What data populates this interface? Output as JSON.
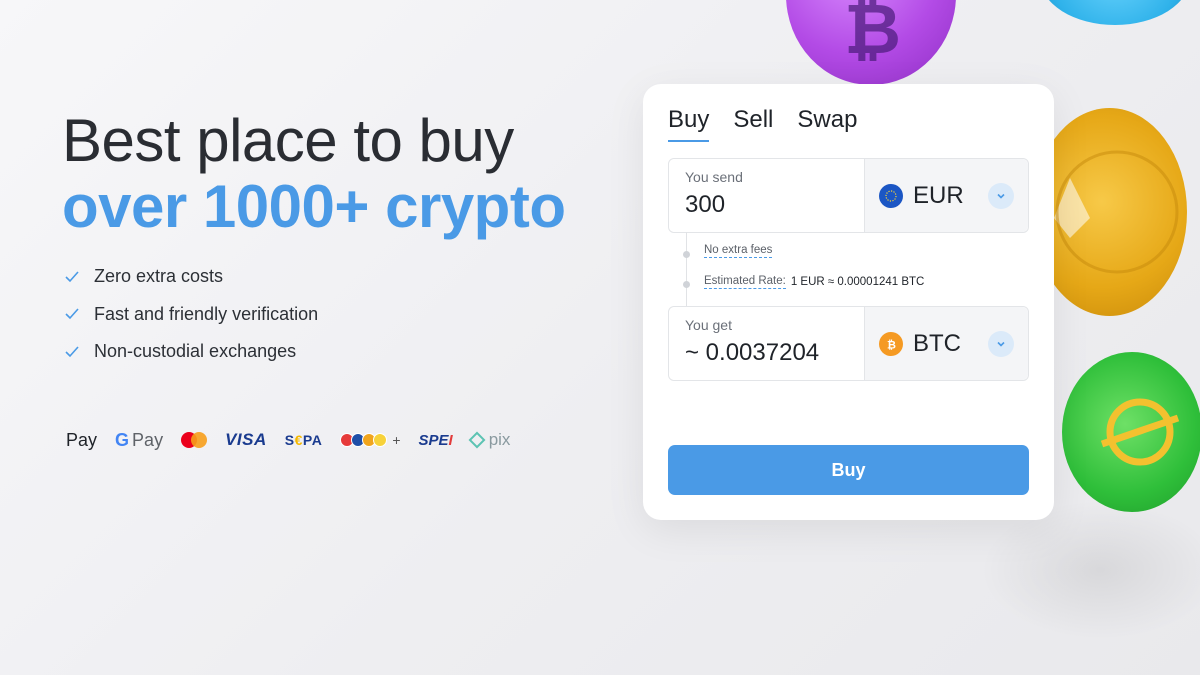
{
  "hero": {
    "line1": "Best place to buy",
    "line2": "over 1000+ crypto"
  },
  "features": [
    "Zero extra costs",
    "Fast and friendly verification",
    "Non-custodial exchanges"
  ],
  "payment_methods": {
    "apple_pay": "Pay",
    "google_pay_g": "G",
    "google_pay": "Pay",
    "visa": "VISA",
    "sepa_left": "S",
    "sepa_e": "€",
    "sepa_right": "PA",
    "bank_plus": "+",
    "spei_left": "SPE",
    "spei_right": "I",
    "pix": "pix"
  },
  "widget": {
    "tabs": [
      "Buy",
      "Sell",
      "Swap"
    ],
    "active_tab": "Buy",
    "send": {
      "label": "You send",
      "value": "300",
      "currency": "EUR",
      "currency_icon": "eu-flag-icon"
    },
    "info": {
      "fees": "No extra fees",
      "rate_label": "Estimated Rate:",
      "rate_value": "1 EUR ≈ 0.00001241 BTC"
    },
    "get": {
      "label": "You get",
      "value": "~ 0.0037204",
      "currency": "BTC",
      "currency_icon": "bitcoin-icon"
    },
    "buy_label": "Buy"
  },
  "colors": {
    "accent": "#4a9ae6",
    "headline": "#2a2d33",
    "check": "#4a9ae6"
  }
}
